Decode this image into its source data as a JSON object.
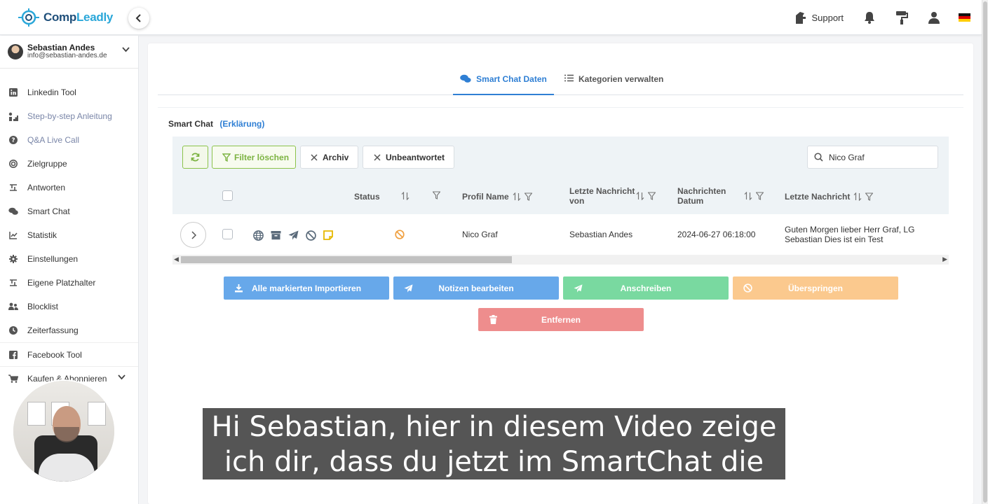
{
  "app": {
    "logo_text_1": "Comp",
    "logo_text_2": "Leadly"
  },
  "header": {
    "support_label": "Support",
    "icons": [
      "support-icon",
      "bell-icon",
      "paint-roller-icon",
      "user-icon",
      "flag-de-icon"
    ]
  },
  "user": {
    "name": "Sebastian Andes",
    "email": "info@sebastian-andes.de"
  },
  "sidebar": {
    "items": [
      {
        "label": "Linkedin Tool",
        "icon": "linkedin-icon"
      },
      {
        "label": "Step-by-step Anleitung",
        "icon": "steps-icon"
      },
      {
        "label": "Q&A Live Call",
        "icon": "question-icon"
      },
      {
        "label": "Zielgruppe",
        "icon": "target-icon"
      },
      {
        "label": "Antworten",
        "icon": "reply-icon"
      },
      {
        "label": "Smart Chat",
        "icon": "chat-icon"
      },
      {
        "label": "Statistik",
        "icon": "chart-icon"
      },
      {
        "label": "Einstellungen",
        "icon": "gear-icon"
      },
      {
        "label": "Eigene Platzhalter",
        "icon": "placeholder-icon"
      },
      {
        "label": "Blocklist",
        "icon": "users-block-icon"
      },
      {
        "label": "Zeiterfassung",
        "icon": "clock-icon"
      },
      {
        "label": "Facebook Tool",
        "icon": "facebook-icon"
      },
      {
        "label": "Kaufen & Abonnieren",
        "icon": "cart-icon"
      }
    ]
  },
  "tabs": {
    "active": "Smart Chat Daten",
    "second": "Kategorien verwalten"
  },
  "section": {
    "title": "Smart Chat",
    "link": "(Erklärung)"
  },
  "toolbar": {
    "filter_clear": "Filter löschen",
    "archiv": "Archiv",
    "unbeantwortet": "Unbeantwortet",
    "search_value": "Nico Graf"
  },
  "table": {
    "headers": {
      "status": "Status",
      "profil_name": "Profil Name",
      "letzte_nachricht_von": "Letzte Nachricht von",
      "nachrichten_datum": "Nachrichten Datum",
      "letzte_nachricht": "Letzte Nachricht"
    },
    "rows": [
      {
        "profil_name": "Nico Graf",
        "letzte_nachricht_von": "Sebastian Andes",
        "nachrichten_datum": "2024-06-27 06:18:00",
        "letzte_nachricht": "Guten Morgen lieber Herr Graf, LG Sebastian Dies ist ein Test"
      }
    ]
  },
  "actions": {
    "import": "Alle markierten Importieren",
    "notes": "Notizen bearbeiten",
    "write": "Anschreiben",
    "skip": "Überspringen",
    "remove": "Entfernen"
  },
  "colors": {
    "primary": "#2f7fd4",
    "import": "#67a8ea",
    "notes": "#67a8ea",
    "write": "#79d9a0",
    "skip": "#fbc98e",
    "remove": "#ee8d8d",
    "filter_green": "#8bc34a"
  },
  "subtitles": {
    "line1": "Hi Sebastian, hier in diesem Video zeige",
    "line2": "ich dir, dass du jetzt im SmartChat die"
  }
}
